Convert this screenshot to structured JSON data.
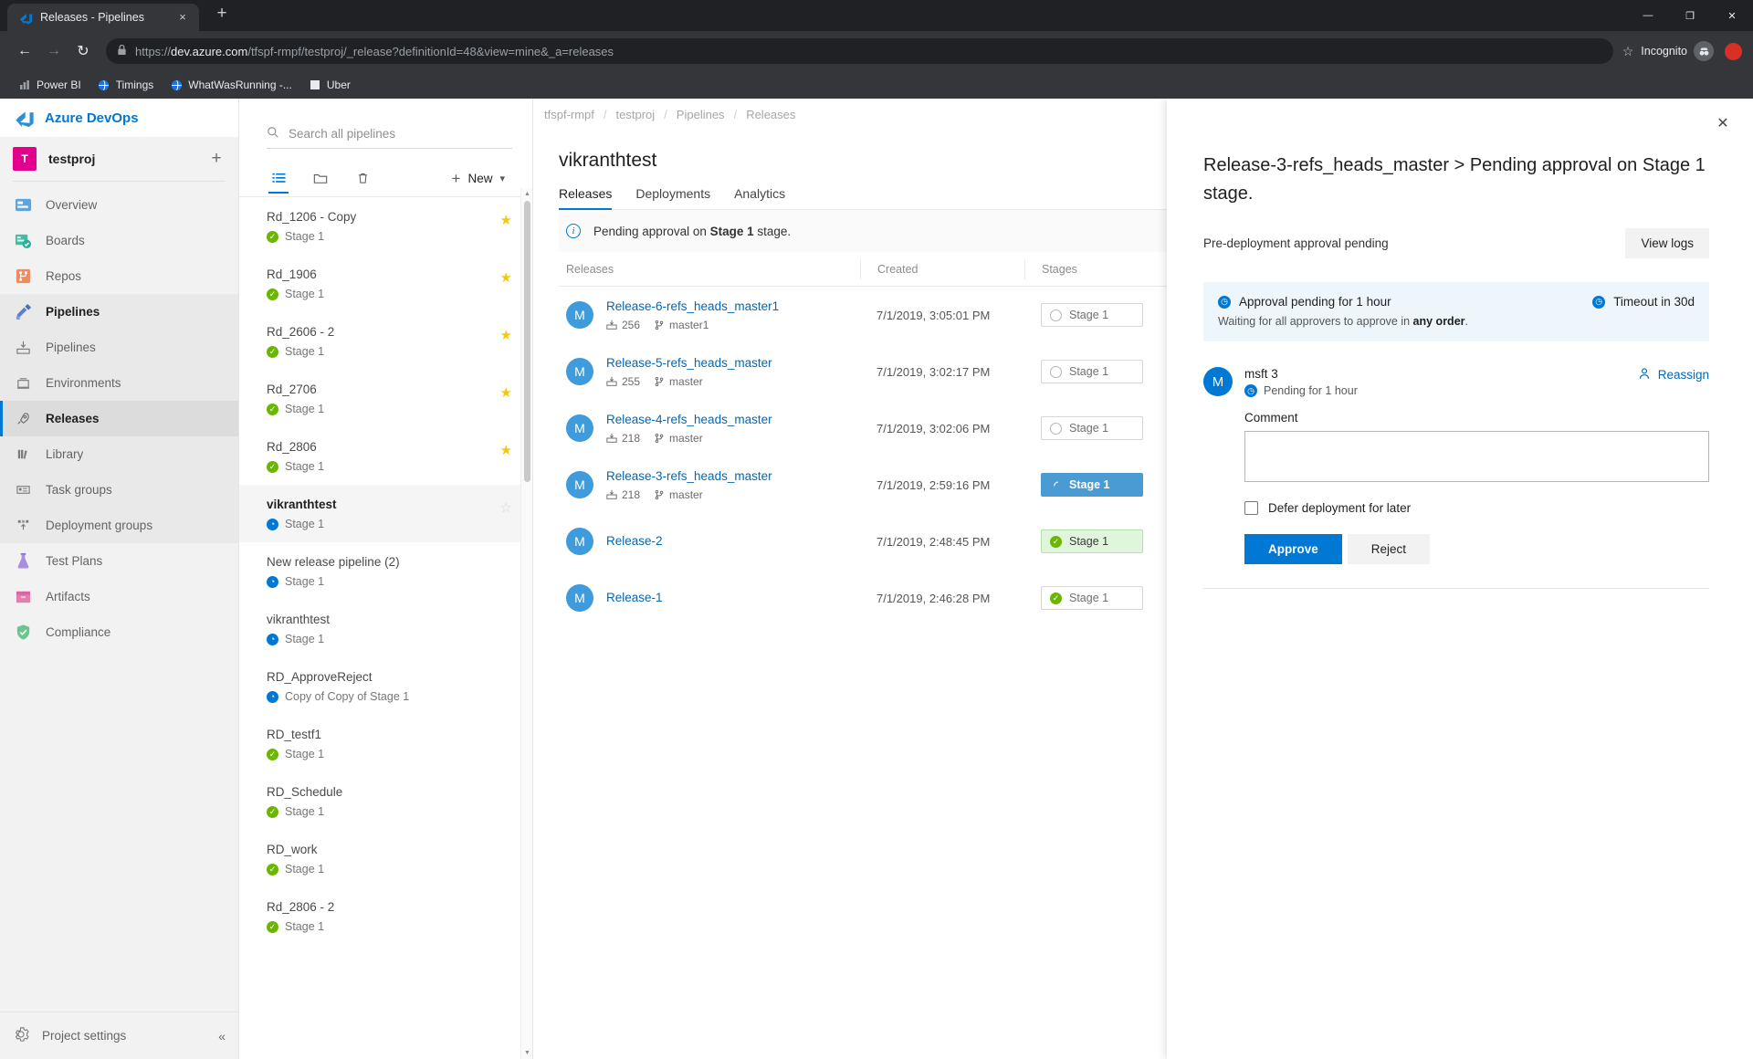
{
  "browser": {
    "tab": {
      "title": "Releases - Pipelines",
      "favicon": "azure-devops-icon",
      "close_label": "×"
    },
    "new_tab_label": "+",
    "window_controls": {
      "minimize": "—",
      "maximize": "❐",
      "close": "✕"
    },
    "nav": {
      "back": "←",
      "forward": "→",
      "reload": "↻"
    },
    "omnibox": {
      "scheme": "https://",
      "host": "dev.azure.com",
      "path": "/tfspf-rmpf/testproj/_release?definitionId=48&view=mine&_a=releases",
      "full_url": "https://dev.azure.com/tfspf-rmpf/testproj/_release?definitionId=48&view=mine&_a=releases",
      "lock": "🔒",
      "star": "☆"
    },
    "incognito_label": "Incognito",
    "bookmarks": [
      {
        "label": "Power BI",
        "icon": "powerbi-icon"
      },
      {
        "label": "Timings",
        "icon": "globe-icon"
      },
      {
        "label": "WhatWasRunning -...",
        "icon": "globe-icon"
      },
      {
        "label": "Uber",
        "icon": "square-icon"
      }
    ]
  },
  "app": {
    "brand": "Azure DevOps",
    "project": {
      "name": "testproj",
      "initial": "T"
    },
    "add_label": "+"
  },
  "sidebar": {
    "items": [
      {
        "label": "Overview",
        "icon": "overview-icon",
        "type": "top"
      },
      {
        "label": "Boards",
        "icon": "boards-icon",
        "type": "top"
      },
      {
        "label": "Repos",
        "icon": "repos-icon",
        "type": "top"
      },
      {
        "label": "Pipelines",
        "icon": "pipelines-icon",
        "type": "group"
      },
      {
        "label": "Pipelines",
        "icon": "pipelines-sub-icon",
        "type": "sub"
      },
      {
        "label": "Environments",
        "icon": "environments-icon",
        "type": "sub"
      },
      {
        "label": "Releases",
        "icon": "releases-rocket-icon",
        "type": "sub",
        "active": true
      },
      {
        "label": "Library",
        "icon": "library-icon",
        "type": "sub"
      },
      {
        "label": "Task groups",
        "icon": "task-groups-icon",
        "type": "sub"
      },
      {
        "label": "Deployment groups",
        "icon": "deployment-groups-icon",
        "type": "sub"
      },
      {
        "label": "Test Plans",
        "icon": "test-plans-icon",
        "type": "top"
      },
      {
        "label": "Artifacts",
        "icon": "artifacts-icon",
        "type": "top"
      },
      {
        "label": "Compliance",
        "icon": "compliance-icon",
        "type": "top"
      }
    ],
    "project_settings": {
      "label": "Project settings",
      "icon": "gear-icon",
      "collapse_icon": "collapse-icon"
    }
  },
  "pipelines_panel": {
    "search_placeholder": "Search all pipelines",
    "search_value": "",
    "toolbar": [
      {
        "name": "list-view",
        "icon": "list-icon",
        "selected": true
      },
      {
        "name": "folder-view",
        "icon": "folder-icon",
        "selected": false
      },
      {
        "name": "delete",
        "icon": "trash-icon",
        "selected": false
      }
    ],
    "new_button": {
      "label": "New",
      "plus": "+",
      "chevron": "⌄"
    },
    "items": [
      {
        "name": "Rd_1206 - Copy",
        "stage": "Stage 1",
        "status": "ok",
        "starred": true,
        "selected": false
      },
      {
        "name": "Rd_1906",
        "stage": "Stage 1",
        "status": "ok",
        "starred": true,
        "selected": false
      },
      {
        "name": "Rd_2606 - 2",
        "stage": "Stage 1",
        "status": "ok",
        "starred": true,
        "selected": false
      },
      {
        "name": "Rd_2706",
        "stage": "Stage 1",
        "status": "ok",
        "starred": true,
        "selected": false
      },
      {
        "name": "Rd_2806",
        "stage": "Stage 1",
        "status": "ok",
        "starred": true,
        "selected": false
      },
      {
        "name": "vikranthtest",
        "stage": "Stage 1",
        "status": "pending",
        "starred": false,
        "selected": true
      },
      {
        "name": "New release pipeline (2)",
        "stage": "Stage 1",
        "status": "pending",
        "starred": false,
        "selected": false
      },
      {
        "name": "vikranthtest",
        "stage": "Stage 1",
        "status": "pending",
        "starred": false,
        "selected": false
      },
      {
        "name": "RD_ApproveReject",
        "stage": "Copy of Copy of Stage 1",
        "status": "pending",
        "starred": false,
        "selected": false
      },
      {
        "name": "RD_testf1",
        "stage": "Stage 1",
        "status": "ok",
        "starred": false,
        "selected": false
      },
      {
        "name": "RD_Schedule",
        "stage": "Stage 1",
        "status": "ok",
        "starred": false,
        "selected": false
      },
      {
        "name": "RD_work",
        "stage": "Stage 1",
        "status": "ok",
        "starred": false,
        "selected": false
      },
      {
        "name": "Rd_2806 - 2",
        "stage": "Stage 1",
        "status": "ok",
        "starred": false,
        "selected": false
      }
    ]
  },
  "breadcrumb": {
    "items": [
      "tfspf-rmpf",
      "testproj",
      "Pipelines",
      "Releases"
    ],
    "separator": "/"
  },
  "main": {
    "title": "vikranthtest",
    "tabs": [
      {
        "label": "Releases",
        "active": true
      },
      {
        "label": "Deployments",
        "active": false
      },
      {
        "label": "Analytics",
        "active": false
      }
    ],
    "banner": {
      "text_before": "Pending approval on ",
      "bold": "Stage 1",
      "text_after": " stage.",
      "icon": "info-icon"
    },
    "table": {
      "headers": {
        "releases": "Releases",
        "created": "Created",
        "stages": "Stages"
      },
      "rows": [
        {
          "avatar": "M",
          "name": "Release-6-refs_heads_master1",
          "build": "256",
          "branch": "master1",
          "created": "7/1/2019, 3:05:01 PM",
          "stage_label": "Stage 1",
          "stage_state": "neutral"
        },
        {
          "avatar": "M",
          "name": "Release-5-refs_heads_master",
          "build": "255",
          "branch": "master",
          "created": "7/1/2019, 3:02:17 PM",
          "stage_label": "Stage 1",
          "stage_state": "neutral"
        },
        {
          "avatar": "M",
          "name": "Release-4-refs_heads_master",
          "build": "218",
          "branch": "master",
          "created": "7/1/2019, 3:02:06 PM",
          "stage_label": "Stage 1",
          "stage_state": "neutral"
        },
        {
          "avatar": "M",
          "name": "Release-3-refs_heads_master",
          "build": "218",
          "branch": "master",
          "created": "7/1/2019, 2:59:16 PM",
          "stage_label": "Stage 1",
          "stage_state": "inprogress"
        },
        {
          "avatar": "M",
          "name": "Release-2",
          "build": "",
          "branch": "",
          "created": "7/1/2019, 2:48:45 PM",
          "stage_label": "Stage 1",
          "stage_state": "succeeded-light"
        },
        {
          "avatar": "M",
          "name": "Release-1",
          "build": "",
          "branch": "",
          "created": "7/1/2019, 2:46:28 PM",
          "stage_label": "Stage 1",
          "stage_state": "succeeded"
        }
      ]
    }
  },
  "approval_panel": {
    "close_label": "✕",
    "title": "Release-3-refs_heads_master > Pending approval on Stage 1 stage.",
    "subtitle": "Pre-deployment approval pending",
    "view_logs_label": "View logs",
    "info": {
      "pending_text": "Approval pending for 1 hour",
      "timeout_text": "Timeout in 30d",
      "waiting_before": "Waiting for all approvers to approve in ",
      "waiting_bold": "any order",
      "waiting_after": "."
    },
    "approver": {
      "avatar": "M",
      "name": "msft 3",
      "status": "Pending for 1 hour",
      "reassign_label": "Reassign"
    },
    "comment": {
      "label": "Comment",
      "value": "",
      "placeholder": ""
    },
    "defer": {
      "label": "Defer deployment for later",
      "checked": false
    },
    "approve_label": "Approve",
    "reject_label": "Reject"
  },
  "colors": {
    "accent": "#0078d4",
    "link": "#0068b8",
    "success": "#6bb700",
    "star": "#f2c811",
    "project_avatar": "#e3008c",
    "inprogress": "#4a9ad4"
  }
}
